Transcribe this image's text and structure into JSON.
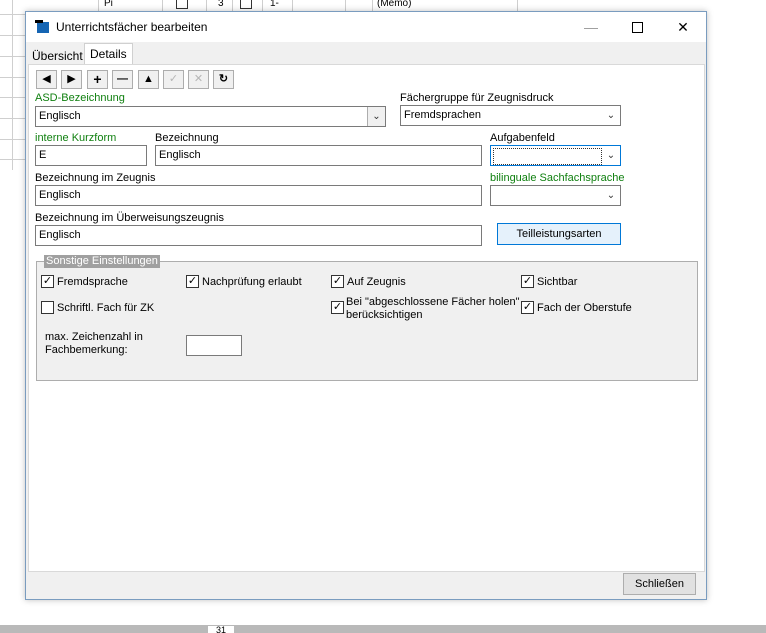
{
  "background": {
    "row_cells": [
      "Pi",
      "3",
      "1-",
      "(Memo)"
    ],
    "page_number": "31"
  },
  "window": {
    "title": "Unterrichtsfächer bearbeiten",
    "minimize_icon": "—",
    "maximize_icon": "max",
    "close_icon": "✕"
  },
  "tabs": {
    "uebersicht": "Übersicht",
    "details": "Details"
  },
  "nav": {
    "first": "◀",
    "next": "▶",
    "add": "+",
    "remove": "—",
    "up": "▲",
    "confirm": "✓",
    "cancel": "✕",
    "refresh": "↻"
  },
  "fields": {
    "asd_label": "ASD-Bezeichnung",
    "asd_value": "Englisch",
    "faechergruppe_label": "Fächergruppe für Zeugnisdruck",
    "faechergruppe_value": "Fremdsprachen",
    "kurzform_label": "interne Kurzform",
    "kurzform_value": "E",
    "bezeichnung_label": "Bezeichnung",
    "bezeichnung_value": "Englisch",
    "aufgabenfeld_label": "Aufgabenfeld",
    "aufgabenfeld_value": "",
    "zeugnis_label": "Bezeichnung im Zeugnis",
    "zeugnis_value": "Englisch",
    "bilingual_label": "bilinguale Sachfachsprache",
    "bilingual_value": "",
    "ueberweisung_label": "Bezeichnung im Überweisungszeugnis",
    "ueberweisung_value": "Englisch",
    "teilleistungen_button": "Teilleistungsarten"
  },
  "sonstige": {
    "title": "Sonstige Einstellungen",
    "fremdsprache": "Fremdsprache",
    "nachpruefung": "Nachprüfung erlaubt",
    "auf_zeugnis": "Auf Zeugnis",
    "sichtbar": "Sichtbar",
    "schriftl_zk": "Schriftl. Fach für ZK",
    "abgeschlossene_line1": "Bei \"abgeschlossene Fächer holen\"",
    "abgeschlossene_line2": "berücksichtigen",
    "oberstufe": "Fach der Oberstufe",
    "max_zeichen_line1": "max. Zeichenzahl in",
    "max_zeichen_line2": "Fachbemerkung:",
    "max_zeichen_value": "",
    "checked": {
      "fremdsprache": true,
      "nachpruefung": true,
      "auf_zeugnis": true,
      "sichtbar": true,
      "schriftl_zk": false,
      "abgeschlossene": true,
      "oberstufe": true
    },
    "check_glyph": "✓"
  },
  "footer": {
    "close_button": "Schließen"
  }
}
